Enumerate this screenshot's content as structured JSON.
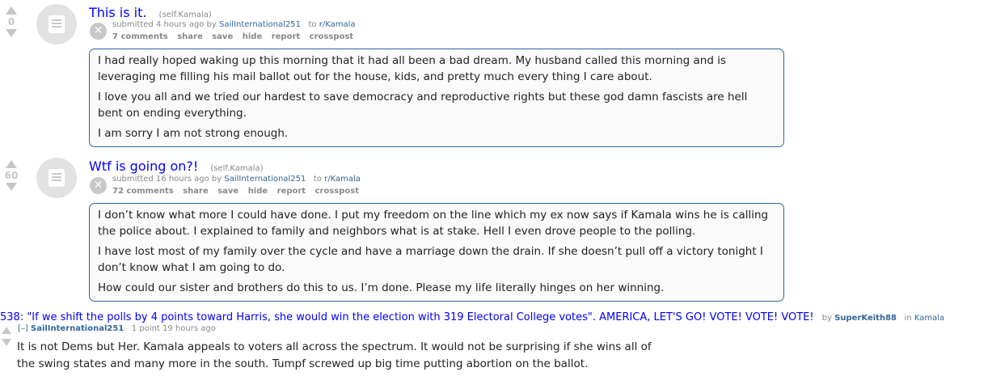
{
  "posts": [
    {
      "score": "0",
      "title": "This is it.",
      "domain": "(self.Kamala)",
      "submitted": "submitted 4 hours ago by",
      "author": "SailInternational251",
      "to": "to",
      "subreddit": "r/Kamala",
      "buttons": [
        "7 comments",
        "share",
        "save",
        "hide",
        "report",
        "crosspost"
      ],
      "paragraphs": [
        "I had really hoped waking up this morning that it had all been a bad dream. My husband called this morning and is leveraging me filling his mail ballot out for the house, kids, and pretty much every thing I care about.",
        "I love you all and we tried our hardest to save democracy and reproductive rights but these god damn fascists are hell bent on ending everything.",
        "I am sorry I am not strong enough."
      ]
    },
    {
      "score": "60",
      "title": "Wtf is going on?!",
      "domain": "(self.Kamala)",
      "submitted": "submitted 16 hours ago by",
      "author": "SailInternational251",
      "to": "to",
      "subreddit": "r/Kamala",
      "buttons": [
        "72 comments",
        "share",
        "save",
        "hide",
        "report",
        "crosspost"
      ],
      "paragraphs": [
        "I don’t know what more I could have done. I put my freedom on the line which my ex now says if Kamala wins he is calling the police about. I explained to family and neighbors what is at stake. Hell I even drove people to the polling.",
        "I have lost most of my family over the cycle and have a marriage down the drain. If she doesn’t pull off a victory tonight I don’t know what I am going to do.",
        "How could our sister and brothers do this to us. I’m done. Please my life literally hinges on her winning."
      ]
    }
  ],
  "comment": {
    "link_title": "538: \"If we shift the polls by 4 points toward Harris, she would win the election with 319 Electoral College votes\". AMERICA, LET'S GO! VOTE! VOTE! VOTE!",
    "by": "by",
    "link_author": "SuperKeith88",
    "in": "in",
    "link_sub": "Kamala",
    "expand": "[–]",
    "author": "SailInternational251",
    "points": "1 point 19 hours ago",
    "body_lines": [
      "It is not Dems but Her. Kamala appeals to voters all across the spectrum. It would not be surprising if she wins all of",
      "the swing states and many more in the south. Tumpf screwed up big time putting abortion on the ballot."
    ]
  },
  "icons": {
    "upvote": "upvote-arrow-icon",
    "downvote": "downvote-arrow-icon",
    "thumbnail": "self-post-document-icon",
    "hide": "close-x-icon"
  },
  "colors": {
    "title": "#0000ff",
    "link": "#336699",
    "muted": "#888888",
    "selftext_border": "#336699"
  }
}
